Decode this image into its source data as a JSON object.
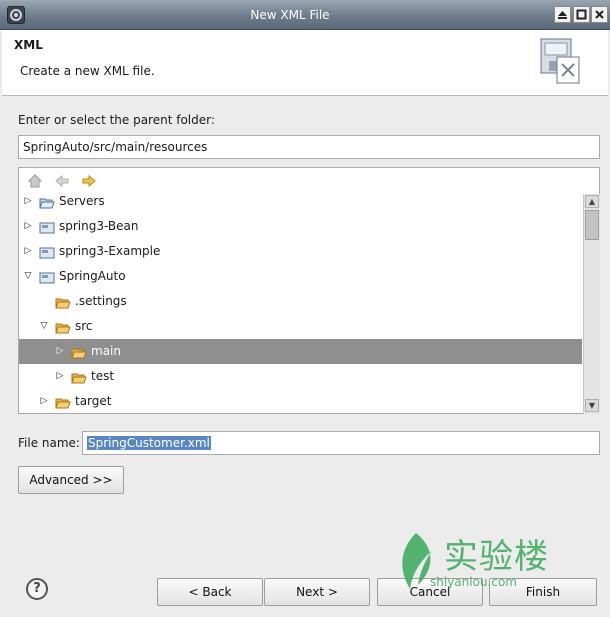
{
  "window": {
    "title": "New XML File"
  },
  "header": {
    "title": "XML",
    "description": "Create a new XML file."
  },
  "parent_folder": {
    "label": "Enter or select the parent folder:",
    "value": "SpringAuto/src/main/resources"
  },
  "tree": {
    "items": [
      {
        "label": "Servers",
        "icon": "folder-open-icon",
        "expanded": false
      },
      {
        "label": "spring3-Bean",
        "icon": "project-icon",
        "expanded": false
      },
      {
        "label": "spring3-Example",
        "icon": "project-icon",
        "expanded": false
      },
      {
        "label": "SpringAuto",
        "icon": "project-icon",
        "expanded": true
      },
      {
        "label": ".settings",
        "icon": "folder-icon",
        "expanded": false
      },
      {
        "label": "src",
        "icon": "folder-icon",
        "expanded": true
      },
      {
        "label": "main",
        "icon": "folder-icon",
        "expanded": false,
        "selected": true
      },
      {
        "label": "test",
        "icon": "folder-icon",
        "expanded": false
      },
      {
        "label": "target",
        "icon": "folder-icon",
        "expanded": false
      }
    ]
  },
  "file_name": {
    "label": "File name:",
    "value": "SpringCustomer.xml"
  },
  "buttons": {
    "advanced": "Advanced >>",
    "back": "< Back",
    "next": "Next >",
    "cancel": "Cancel",
    "finish": "Finish"
  },
  "help": {
    "glyph": "?"
  },
  "watermark": {
    "brand": "实验楼",
    "url": "shiyanlou.com"
  },
  "colors": {
    "selection": "#8f8f8f",
    "text_selection": "#5a87c3",
    "watermark": "#39a85b"
  }
}
